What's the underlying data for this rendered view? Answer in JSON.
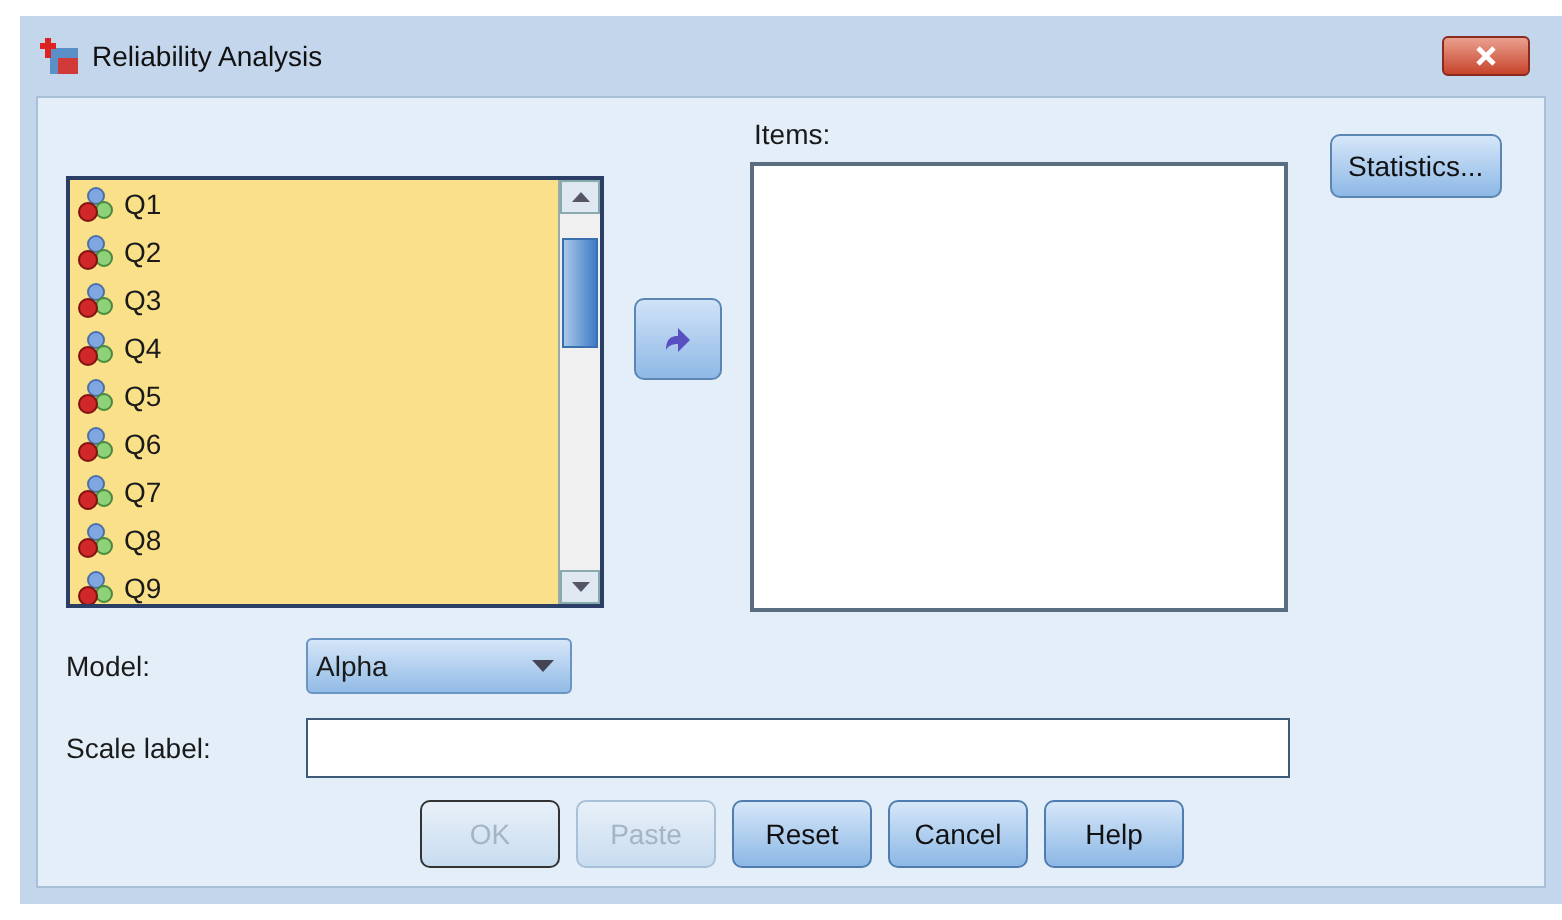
{
  "window": {
    "title": "Reliability Analysis"
  },
  "variables": [
    {
      "label": "Q1"
    },
    {
      "label": "Q2"
    },
    {
      "label": "Q3"
    },
    {
      "label": "Q4"
    },
    {
      "label": "Q5"
    },
    {
      "label": "Q6"
    },
    {
      "label": "Q7"
    },
    {
      "label": "Q8"
    },
    {
      "label": "Q9"
    }
  ],
  "items": {
    "label": "Items:"
  },
  "statistics_button": {
    "label": "Statistics..."
  },
  "model": {
    "label": "Model:",
    "value": "Alpha"
  },
  "scale_label": {
    "label": "Scale label:"
  },
  "buttons": [
    {
      "label": "OK",
      "disabled": true
    },
    {
      "label": "Paste",
      "disabled": true
    },
    {
      "label": "Reset",
      "disabled": false
    },
    {
      "label": "Cancel",
      "disabled": false
    },
    {
      "label": "Help",
      "disabled": false
    }
  ]
}
